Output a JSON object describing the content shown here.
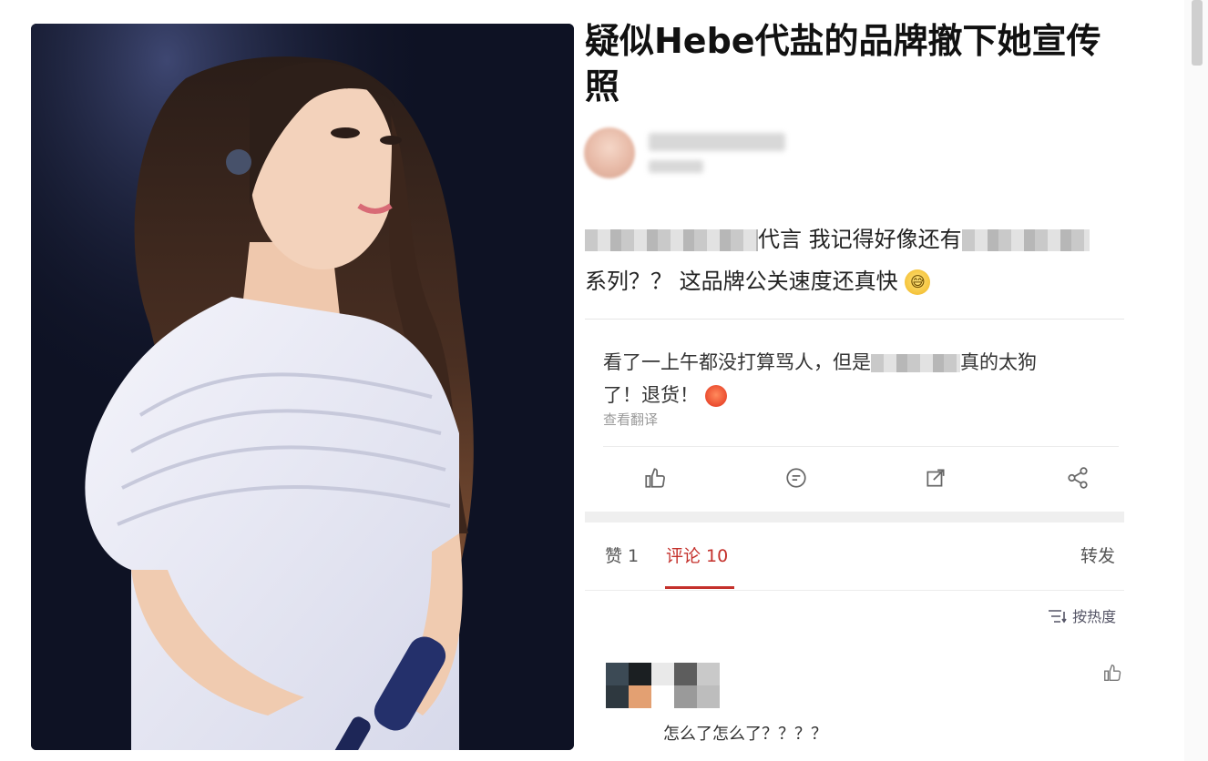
{
  "article": {
    "title": "疑似Hebe代盐的品牌撤下她宣传照"
  },
  "post": {
    "line1_visible": "代言 我记得好像还有",
    "line2": "系列？？ 这品牌公关速度还真快"
  },
  "comment": {
    "line1_a": "看了一上午都没打算骂人，但是",
    "line1_b": "真的太狗",
    "line2": "了！退货！",
    "translate_label": "查看翻译"
  },
  "tabs": {
    "likes": "赞 1",
    "comments": "评论 10",
    "reposts": "转发"
  },
  "sort": {
    "label": "按热度"
  },
  "reply": {
    "text": "怎么了怎么了？？？？"
  },
  "icons": {
    "like": "thumbs-up-icon",
    "comment": "comment-icon",
    "repost": "repost-icon",
    "share": "share-icon",
    "sort": "sort-icon"
  },
  "colors": {
    "accent": "#c4302b",
    "photo_bg": "#0e1224"
  }
}
